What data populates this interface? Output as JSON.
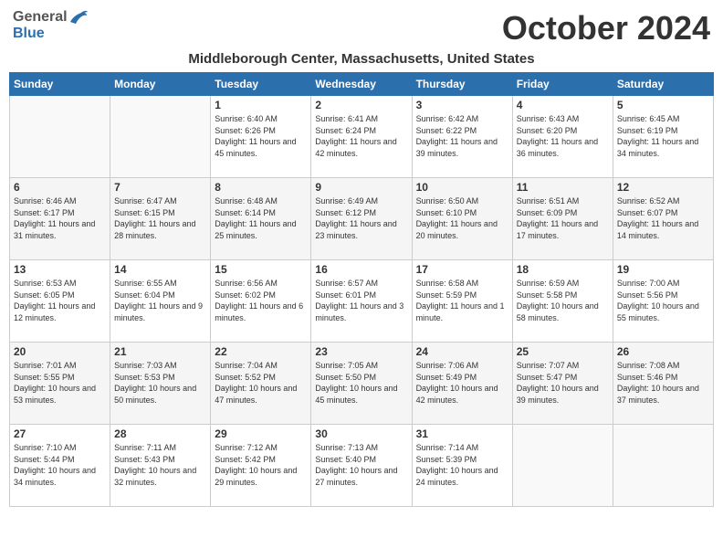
{
  "header": {
    "logo_general": "General",
    "logo_blue": "Blue",
    "month_title": "October 2024",
    "location": "Middleborough Center, Massachusetts, United States"
  },
  "weekdays": [
    "Sunday",
    "Monday",
    "Tuesday",
    "Wednesday",
    "Thursday",
    "Friday",
    "Saturday"
  ],
  "weeks": [
    [
      {
        "day": "",
        "info": ""
      },
      {
        "day": "",
        "info": ""
      },
      {
        "day": "1",
        "info": "Sunrise: 6:40 AM\nSunset: 6:26 PM\nDaylight: 11 hours and 45 minutes."
      },
      {
        "day": "2",
        "info": "Sunrise: 6:41 AM\nSunset: 6:24 PM\nDaylight: 11 hours and 42 minutes."
      },
      {
        "day": "3",
        "info": "Sunrise: 6:42 AM\nSunset: 6:22 PM\nDaylight: 11 hours and 39 minutes."
      },
      {
        "day": "4",
        "info": "Sunrise: 6:43 AM\nSunset: 6:20 PM\nDaylight: 11 hours and 36 minutes."
      },
      {
        "day": "5",
        "info": "Sunrise: 6:45 AM\nSunset: 6:19 PM\nDaylight: 11 hours and 34 minutes."
      }
    ],
    [
      {
        "day": "6",
        "info": "Sunrise: 6:46 AM\nSunset: 6:17 PM\nDaylight: 11 hours and 31 minutes."
      },
      {
        "day": "7",
        "info": "Sunrise: 6:47 AM\nSunset: 6:15 PM\nDaylight: 11 hours and 28 minutes."
      },
      {
        "day": "8",
        "info": "Sunrise: 6:48 AM\nSunset: 6:14 PM\nDaylight: 11 hours and 25 minutes."
      },
      {
        "day": "9",
        "info": "Sunrise: 6:49 AM\nSunset: 6:12 PM\nDaylight: 11 hours and 23 minutes."
      },
      {
        "day": "10",
        "info": "Sunrise: 6:50 AM\nSunset: 6:10 PM\nDaylight: 11 hours and 20 minutes."
      },
      {
        "day": "11",
        "info": "Sunrise: 6:51 AM\nSunset: 6:09 PM\nDaylight: 11 hours and 17 minutes."
      },
      {
        "day": "12",
        "info": "Sunrise: 6:52 AM\nSunset: 6:07 PM\nDaylight: 11 hours and 14 minutes."
      }
    ],
    [
      {
        "day": "13",
        "info": "Sunrise: 6:53 AM\nSunset: 6:05 PM\nDaylight: 11 hours and 12 minutes."
      },
      {
        "day": "14",
        "info": "Sunrise: 6:55 AM\nSunset: 6:04 PM\nDaylight: 11 hours and 9 minutes."
      },
      {
        "day": "15",
        "info": "Sunrise: 6:56 AM\nSunset: 6:02 PM\nDaylight: 11 hours and 6 minutes."
      },
      {
        "day": "16",
        "info": "Sunrise: 6:57 AM\nSunset: 6:01 PM\nDaylight: 11 hours and 3 minutes."
      },
      {
        "day": "17",
        "info": "Sunrise: 6:58 AM\nSunset: 5:59 PM\nDaylight: 11 hours and 1 minute."
      },
      {
        "day": "18",
        "info": "Sunrise: 6:59 AM\nSunset: 5:58 PM\nDaylight: 10 hours and 58 minutes."
      },
      {
        "day": "19",
        "info": "Sunrise: 7:00 AM\nSunset: 5:56 PM\nDaylight: 10 hours and 55 minutes."
      }
    ],
    [
      {
        "day": "20",
        "info": "Sunrise: 7:01 AM\nSunset: 5:55 PM\nDaylight: 10 hours and 53 minutes."
      },
      {
        "day": "21",
        "info": "Sunrise: 7:03 AM\nSunset: 5:53 PM\nDaylight: 10 hours and 50 minutes."
      },
      {
        "day": "22",
        "info": "Sunrise: 7:04 AM\nSunset: 5:52 PM\nDaylight: 10 hours and 47 minutes."
      },
      {
        "day": "23",
        "info": "Sunrise: 7:05 AM\nSunset: 5:50 PM\nDaylight: 10 hours and 45 minutes."
      },
      {
        "day": "24",
        "info": "Sunrise: 7:06 AM\nSunset: 5:49 PM\nDaylight: 10 hours and 42 minutes."
      },
      {
        "day": "25",
        "info": "Sunrise: 7:07 AM\nSunset: 5:47 PM\nDaylight: 10 hours and 39 minutes."
      },
      {
        "day": "26",
        "info": "Sunrise: 7:08 AM\nSunset: 5:46 PM\nDaylight: 10 hours and 37 minutes."
      }
    ],
    [
      {
        "day": "27",
        "info": "Sunrise: 7:10 AM\nSunset: 5:44 PM\nDaylight: 10 hours and 34 minutes."
      },
      {
        "day": "28",
        "info": "Sunrise: 7:11 AM\nSunset: 5:43 PM\nDaylight: 10 hours and 32 minutes."
      },
      {
        "day": "29",
        "info": "Sunrise: 7:12 AM\nSunset: 5:42 PM\nDaylight: 10 hours and 29 minutes."
      },
      {
        "day": "30",
        "info": "Sunrise: 7:13 AM\nSunset: 5:40 PM\nDaylight: 10 hours and 27 minutes."
      },
      {
        "day": "31",
        "info": "Sunrise: 7:14 AM\nSunset: 5:39 PM\nDaylight: 10 hours and 24 minutes."
      },
      {
        "day": "",
        "info": ""
      },
      {
        "day": "",
        "info": ""
      }
    ]
  ]
}
